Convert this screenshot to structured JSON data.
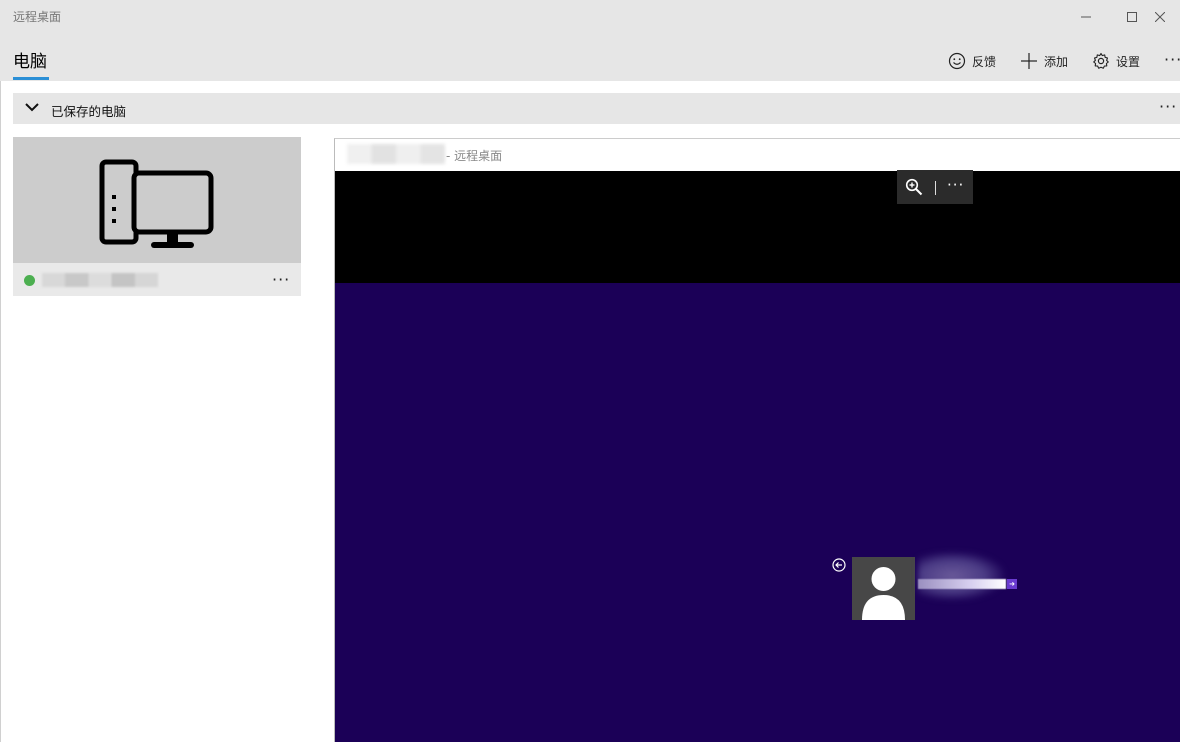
{
  "window": {
    "title": "远程桌面",
    "controls": [
      "minimize-icon",
      "maximize-icon",
      "close-icon"
    ]
  },
  "header": {
    "tab_label": "电脑",
    "commands": {
      "feedback": "反馈",
      "add": "添加",
      "settings": "设置",
      "more": "···"
    }
  },
  "group": {
    "label": "已保存的电脑",
    "more": "···"
  },
  "pc_card": {
    "status_color": "#4caf50",
    "more": "···"
  },
  "remote_session": {
    "title_suffix": "- 远程桌面",
    "toolbar_more": "···",
    "background_color": "#1b0057"
  },
  "colors": {
    "accent": "#2b8fd6",
    "chrome": "#e6e6e6"
  }
}
